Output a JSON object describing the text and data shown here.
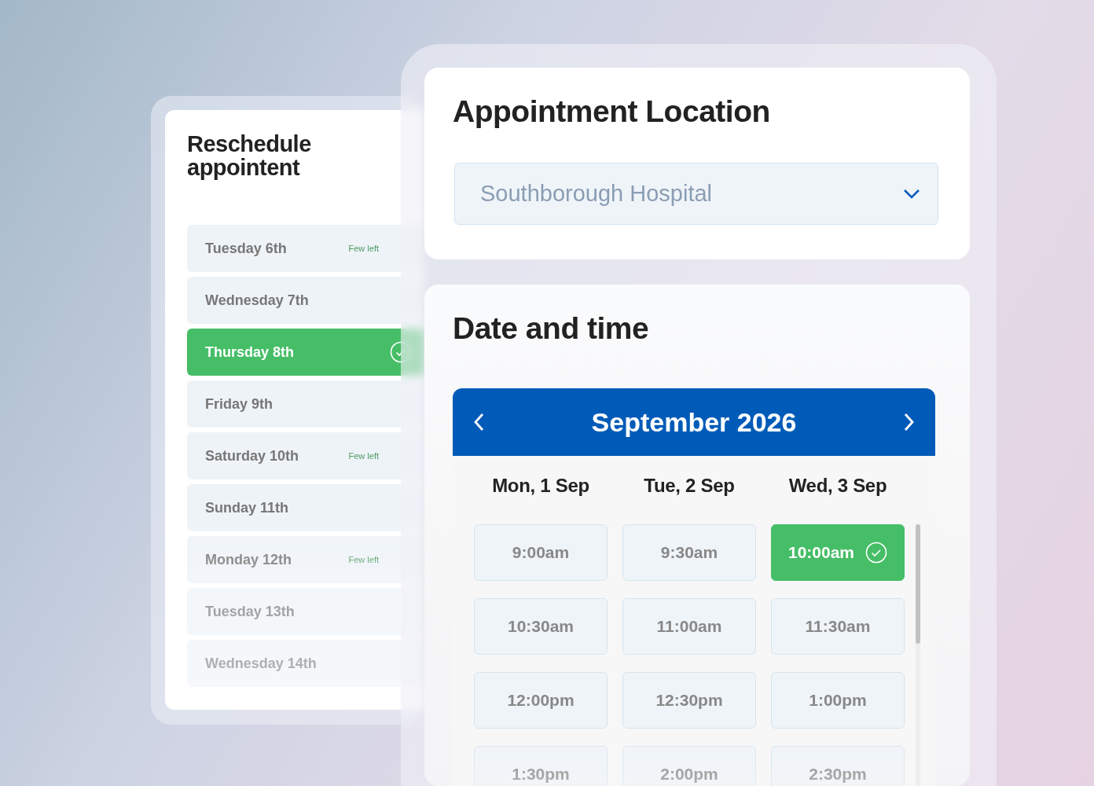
{
  "reschedule": {
    "title": "Reschedule appointent",
    "days": [
      {
        "label": "Tuesday 6th",
        "badge": "Few left",
        "selected": false
      },
      {
        "label": "Wednesday 7th",
        "selected": false
      },
      {
        "label": "Thursday 8th",
        "selected": true
      },
      {
        "label": "Friday 9th",
        "selected": false
      },
      {
        "label": "Saturday 10th",
        "badge": "Few left",
        "selected": false
      },
      {
        "label": "Sunday 11th",
        "selected": false
      },
      {
        "label": "Monday 12th",
        "badge": "Few left",
        "selected": false
      },
      {
        "label": "Tuesday 13th",
        "selected": false
      },
      {
        "label": "Wednesday 14th",
        "selected": false
      }
    ]
  },
  "location": {
    "title": "Appointment Location",
    "value": "Southborough Hospital"
  },
  "date_time": {
    "title": "Date and time",
    "month": "September 2026",
    "days": [
      "Mon, 1 Sep",
      "Tue, 2 Sep",
      "Wed, 3 Sep"
    ],
    "slots": [
      {
        "time": "9:00am",
        "selected": false
      },
      {
        "time": "9:30am",
        "selected": false
      },
      {
        "time": "10:00am",
        "selected": true
      },
      {
        "time": "10:30am",
        "selected": false
      },
      {
        "time": "11:00am",
        "selected": false
      },
      {
        "time": "11:30am",
        "selected": false
      },
      {
        "time": "12:00pm",
        "selected": false
      },
      {
        "time": "12:30pm",
        "selected": false
      },
      {
        "time": "1:00pm",
        "selected": false
      },
      {
        "time": "1:30pm",
        "selected": false
      },
      {
        "time": "2:00pm",
        "selected": false
      },
      {
        "time": "2:30pm",
        "selected": false
      }
    ]
  }
}
